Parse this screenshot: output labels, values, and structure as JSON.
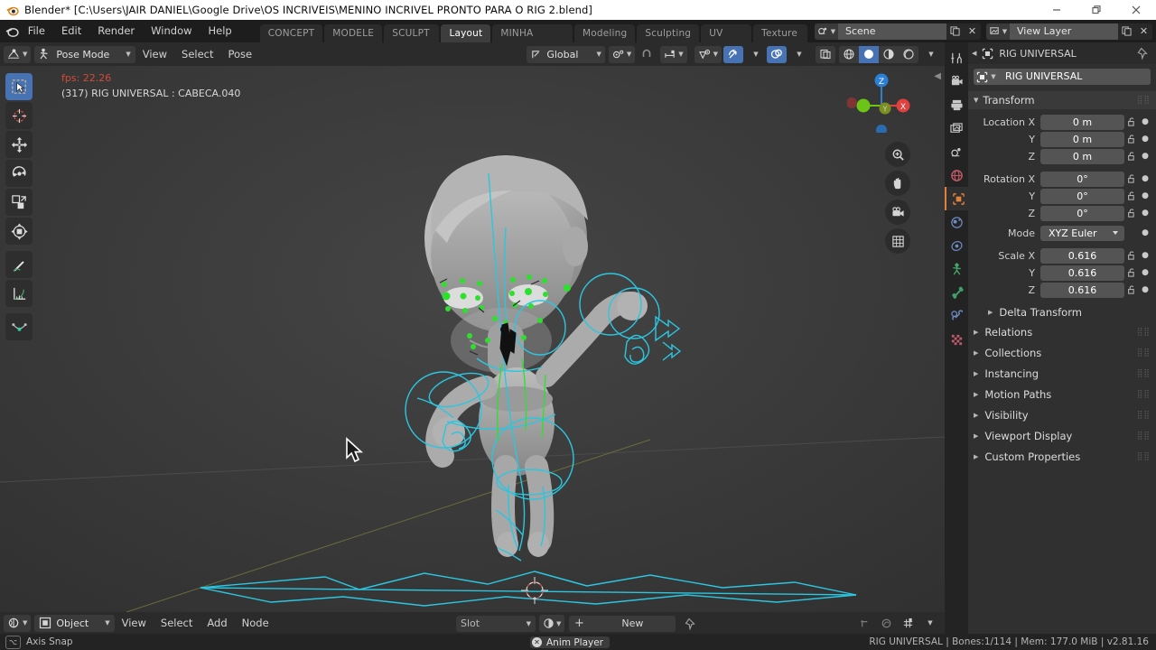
{
  "window": {
    "title": "Blender* [C:\\Users\\JAIR DANIEL\\Google Drive\\OS INCRIVEIS\\MENINO INCRIVEL PRONTO PARA O RIG 2.blend]",
    "logo_icon": "blender-logo-icon",
    "minimize_icon": "minimize-icon",
    "maximize_icon": "restore-icon",
    "close_icon": "close-icon"
  },
  "topbar": {
    "app_icon": "blender-logo-icon",
    "menus": [
      "File",
      "Edit",
      "Render",
      "Window",
      "Help"
    ],
    "workspaces": [
      {
        "label": "CONCEPT ART",
        "active": false
      },
      {
        "label": "MODELE ART",
        "active": false
      },
      {
        "label": "SCULPT ART",
        "active": false
      },
      {
        "label": "Layout",
        "active": true
      },
      {
        "label": "MINHA WORKSPACE",
        "active": false
      },
      {
        "label": "Modeling",
        "active": false
      },
      {
        "label": "Sculpting",
        "active": false
      },
      {
        "label": "UV Editing",
        "active": false
      },
      {
        "label": "Texture Pair",
        "active": false
      }
    ],
    "scene": {
      "name": "Scene",
      "icon": "scene-icon",
      "copy_icon": "new-scene-icon",
      "delete_icon": "unlink-icon"
    },
    "view_layer": {
      "name": "View Layer",
      "icon": "view-layer-icon",
      "copy_icon": "new-layer-icon",
      "delete_icon": "unlink-icon"
    }
  },
  "viewport": {
    "editor_type_icon": "editor-type-3dview-icon",
    "mode": "Pose Mode",
    "mode_icon": "pose-mode-icon",
    "menus": [
      "View",
      "Select",
      "Pose"
    ],
    "transform_orientation": {
      "label": "Global",
      "icon": "orientation-icon"
    },
    "pivot_icon": "pivot-point-icon",
    "snap_icon": "snap-magnet-icon",
    "snap_target_icon": "snap-target-icon",
    "proportional_icon": "proportional-edit-icon",
    "visibility_icon": "object-visibility-icon",
    "gizmo_icon": "gizmo-icon",
    "overlays_icon": "overlays-icon",
    "xray_icon": "xray-toggle-icon",
    "shading": [
      {
        "icon": "shading-wireframe-icon",
        "active": false
      },
      {
        "icon": "shading-solid-icon",
        "active": true
      },
      {
        "icon": "shading-material-icon",
        "active": false
      },
      {
        "icon": "shading-rendered-icon",
        "active": false
      }
    ],
    "overlay_fps": "fps: 22.26",
    "overlay_object": "(317) RIG UNIVERSAL : CABECA.040",
    "fps_color": "#d14b3c",
    "background_color": "#3b3b3b",
    "toolbar": [
      {
        "icon": "tweak-select-box-icon",
        "active": true
      },
      {
        "icon": "cursor-3d-icon",
        "active": false
      },
      {
        "icon": "move-tool-icon",
        "active": false
      },
      {
        "icon": "rotate-tool-icon",
        "active": false
      },
      {
        "icon": "scale-tool-icon",
        "active": false
      },
      {
        "icon": "transform-tool-icon",
        "active": false
      },
      {
        "icon": "annotate-tool-icon",
        "active": false
      },
      {
        "icon": "measure-tool-icon",
        "active": false
      },
      {
        "icon": "breakdowner-tool-icon",
        "active": false
      }
    ],
    "gizmo_axes": [
      {
        "label": "Z",
        "color": "#2b7fd4"
      },
      {
        "label": "Y",
        "color": "#6cc417"
      },
      {
        "label": "X",
        "color": "#e0403f"
      }
    ],
    "nav_buttons": [
      {
        "icon": "zoom-view-icon"
      },
      {
        "icon": "pan-view-icon"
      },
      {
        "icon": "camera-view-icon"
      },
      {
        "icon": "toggle-ortho-icon"
      }
    ],
    "sidebar_arrow_icon": "sidebar-open-arrow-icon",
    "rig_control_color": "#2bc6e0",
    "rig_facial_color": "#2ee02e",
    "mouse_cursor_icon": "mouse-pointer-icon"
  },
  "shader_editor": {
    "editor_type_icon": "editor-type-shader-icon",
    "shader_type": "Object",
    "shader_type_icon": "object-data-icon",
    "menus": [
      "View",
      "Select",
      "Add",
      "Node"
    ],
    "slot_label": "Slot",
    "material_icon": "material-icon",
    "plus_label": "+",
    "new_label": "New",
    "pin_icon": "pin-icon",
    "snap_back_icon": "snap-back-icon",
    "proportional_icon": "proportional-edit-icon",
    "snap_grid_icon": "snap-grid-icon"
  },
  "properties": {
    "tabs": [
      {
        "icon": "tool-tab-icon",
        "active": false
      },
      {
        "icon": "render-tab-icon",
        "active": false
      },
      {
        "icon": "output-tab-icon",
        "active": false
      },
      {
        "icon": "view-layer-tab-icon",
        "active": false
      },
      {
        "icon": "scene-tab-icon",
        "active": false
      },
      {
        "icon": "world-tab-icon",
        "active": false
      },
      {
        "icon": "object-tab-icon",
        "active": true
      },
      {
        "icon": "modifier-tab-icon",
        "active": false
      },
      {
        "icon": "physics-tab-icon",
        "active": false
      },
      {
        "icon": "armature-data-tab-icon",
        "active": false
      },
      {
        "icon": "bone-tab-icon",
        "active": false
      },
      {
        "icon": "bone-constraint-tab-icon",
        "active": false
      },
      {
        "icon": "texture-tab-icon",
        "active": false
      }
    ],
    "breadcrumb": "RIG UNIVERSAL",
    "breadcrumb_icon": "object-data-icon",
    "pin_icon": "pin-icon",
    "id_name": "RIG UNIVERSAL",
    "id_icon": "object-data-icon",
    "transform_panel": {
      "title": "Transform",
      "rows": [
        {
          "label": "Location X",
          "value": "0 m",
          "lock_icon": "unlocked-icon",
          "anim_icon": "animate-dot-icon"
        },
        {
          "label": "Y",
          "value": "0 m",
          "lock_icon": "unlocked-icon",
          "anim_icon": "animate-dot-icon"
        },
        {
          "label": "Z",
          "value": "0 m",
          "lock_icon": "unlocked-icon",
          "anim_icon": "animate-dot-icon"
        },
        {
          "label": "Rotation X",
          "value": "0°",
          "lock_icon": "unlocked-icon",
          "anim_icon": "animate-dot-icon"
        },
        {
          "label": "Y",
          "value": "0°",
          "lock_icon": "unlocked-icon",
          "anim_icon": "animate-dot-icon"
        },
        {
          "label": "Z",
          "value": "0°",
          "lock_icon": "unlocked-icon",
          "anim_icon": "animate-dot-icon"
        }
      ],
      "mode_label": "Mode",
      "mode_value": "XYZ Euler",
      "scale_rows": [
        {
          "label": "Scale X",
          "value": "0.616",
          "lock_icon": "unlocked-icon",
          "anim_icon": "animate-dot-icon"
        },
        {
          "label": "Y",
          "value": "0.616",
          "lock_icon": "unlocked-icon",
          "anim_icon": "animate-dot-icon"
        },
        {
          "label": "Z",
          "value": "0.616",
          "lock_icon": "unlocked-icon",
          "anim_icon": "animate-dot-icon"
        }
      ],
      "delta_transform": "Delta Transform"
    },
    "collapsed_panels": [
      "Relations",
      "Collections",
      "Instancing",
      "Motion Paths",
      "Visibility",
      "Viewport Display",
      "Custom Properties"
    ]
  },
  "statusbar": {
    "key_hint_icon": "alt-key-icon",
    "key_hint_label": "⌥",
    "hint_text": "Axis Snap",
    "anim_player_close_icon": "close-circle-icon",
    "anim_player_label": "Anim Player",
    "info": "RIG UNIVERSAL | Bones:1/114  | Mem: 177.0 MiB | v2.81.16"
  }
}
